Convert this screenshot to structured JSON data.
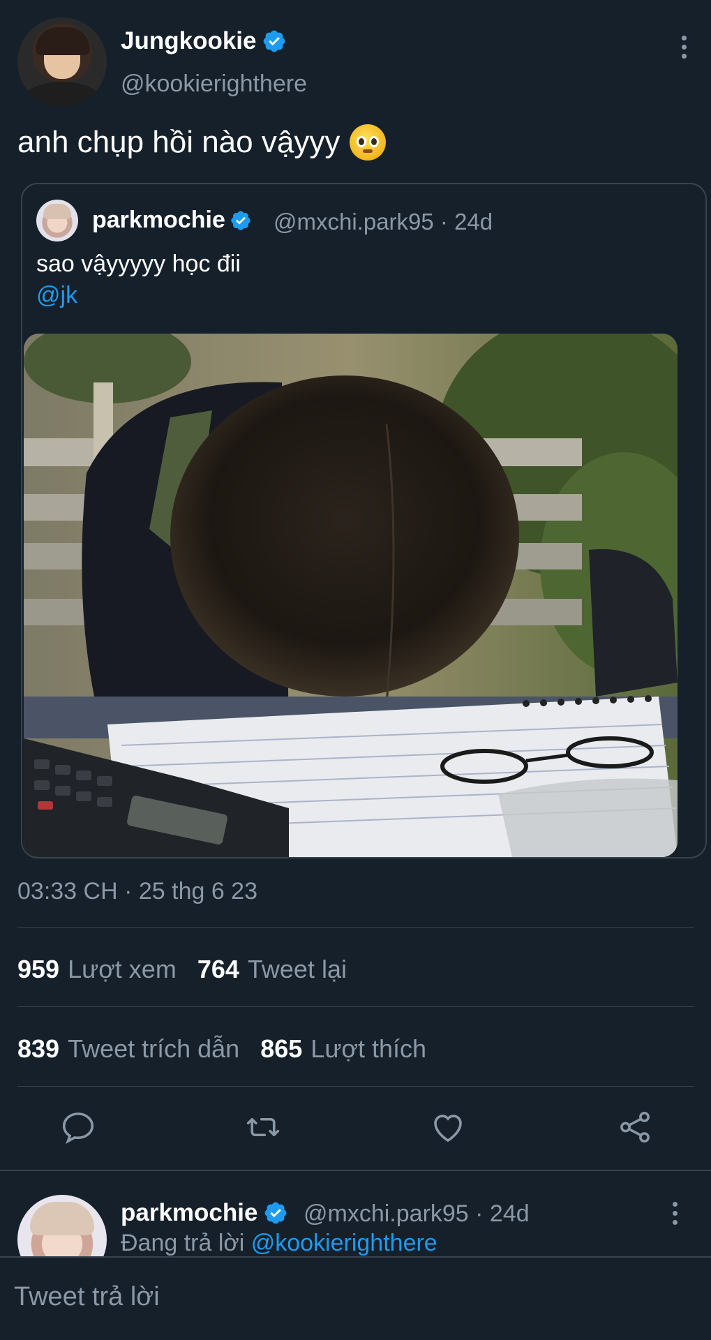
{
  "tweet": {
    "author_name": "Jungkookie",
    "author_handle": "@kookierighthere",
    "text": "anh chụp hồi nào vậyyy",
    "timestamp": "03:33 CH · 25 thg 6 23"
  },
  "quote": {
    "author_name": "parkmochie",
    "author_handle": "@mxchi.park95 · 24d",
    "text": "sao vậyyyyy học đii",
    "mention": "@jk"
  },
  "stats": {
    "views_count": "959",
    "views_label": "Lượt xem",
    "retweets_count": "764",
    "retweets_label": "Tweet lại",
    "quotes_count": "839",
    "quotes_label": "Tweet trích dẫn",
    "likes_count": "865",
    "likes_label": "Lượt thích"
  },
  "reply": {
    "author_name": "parkmochie",
    "author_handle": "@mxchi.park95 · 24d",
    "replying_prefix": "Đang trả lời",
    "replying_to": "@kookierighthere"
  },
  "composer": {
    "placeholder": "Tweet trả lời"
  },
  "colors": {
    "background": "#15202b",
    "accent": "#1d9bf0",
    "secondary_text": "#8b98a5",
    "border": "#38444d"
  },
  "icons": [
    "verified-badge-icon",
    "more-options-icon",
    "reply-icon",
    "retweet-icon",
    "like-icon",
    "share-icon"
  ]
}
